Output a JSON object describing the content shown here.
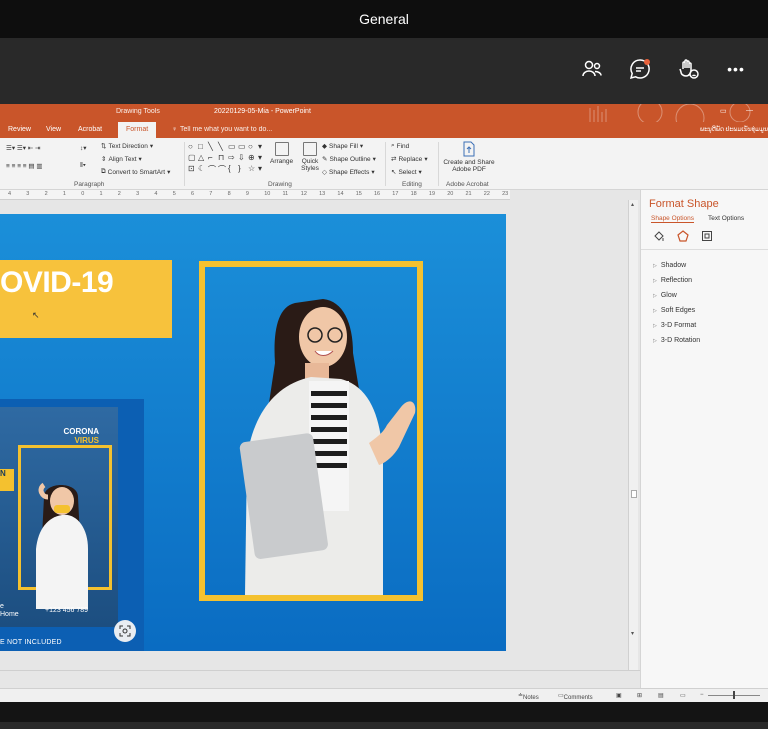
{
  "teams": {
    "title": "General",
    "icons": [
      "people-icon",
      "chat-icon",
      "raise-hand-icon",
      "more-icon"
    ],
    "more_label": "•••"
  },
  "ppt": {
    "context_label": "Drawing Tools",
    "doc_title": "20220129-05-Mia - PowerPoint",
    "tabs": [
      "Review",
      "View",
      "Acrobat",
      "Format"
    ],
    "active_tab": "Format",
    "tell_me": "Tell me what you want to do...",
    "user": "ພະນຸດີພັດ ປະພມເນັນທຸ່ມມູນ",
    "ribbon": {
      "text_direction": "Text Direction",
      "align_text": "Align Text",
      "convert_smartart": "Convert to SmartArt",
      "arrange": "Arrange",
      "quick_styles": "Quick Styles",
      "shape_fill": "Shape Fill",
      "shape_outline": "Shape Outline",
      "shape_effects": "Shape Effects",
      "find": "Find",
      "replace": "Replace",
      "select": "Select",
      "create_share": "Create and Share Adobe PDF",
      "groups": {
        "paragraph": "Paragraph",
        "drawing": "Drawing",
        "editing": "Editing",
        "adobe": "Adobe Acrobat"
      }
    },
    "ruler": [
      "4",
      "3",
      "2",
      "1",
      "0",
      "1",
      "2",
      "3",
      "4",
      "5",
      "6",
      "7",
      "8",
      "9",
      "10",
      "11",
      "12",
      "13",
      "14",
      "15",
      "16",
      "17",
      "18",
      "19",
      "20",
      "21",
      "22",
      "23"
    ],
    "slide": {
      "heading": "OVID-19",
      "corona_line1": "CORONA",
      "corona_line2": "VIRUS",
      "badge_text": "N",
      "home_line1": "e",
      "home_line2": "Home",
      "phone": "+123 456 789",
      "not_included": "E NOT INCLUDED"
    },
    "format_pane": {
      "title": "Format Shape",
      "tab_shape": "Shape Options",
      "tab_text": "Text Options",
      "items": [
        "Shadow",
        "Reflection",
        "Glow",
        "Soft Edges",
        "3-D Format",
        "3-D Rotation"
      ]
    },
    "status": {
      "notes": "Notes",
      "comments": "Comments"
    }
  },
  "colors": {
    "ppt_accent": "#c9552a",
    "slide_yellow": "#f4c12f",
    "slide_blue": "#0a6cc2"
  }
}
